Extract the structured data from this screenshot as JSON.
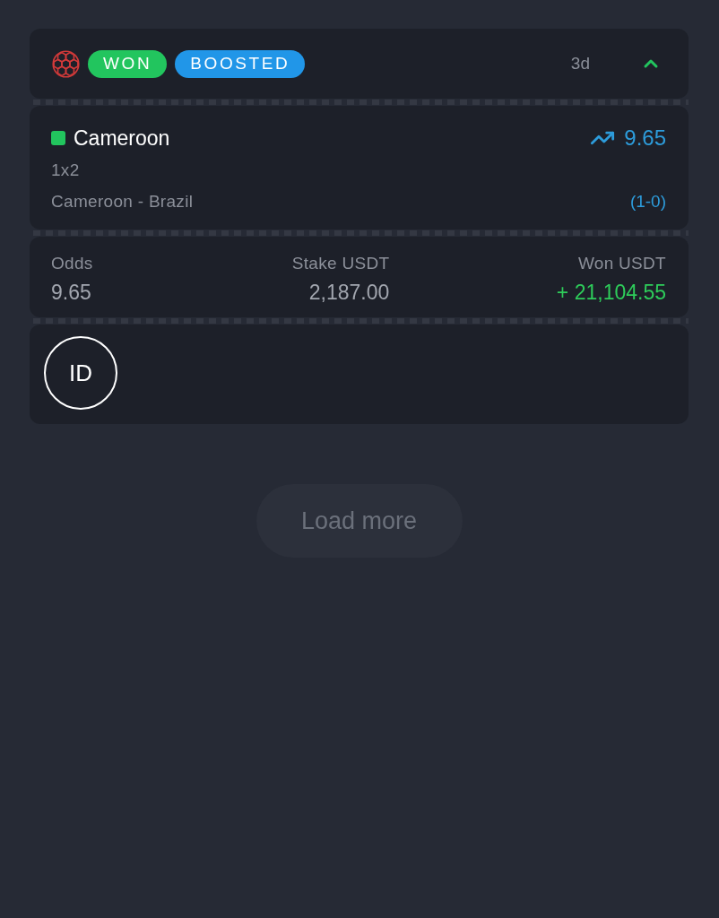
{
  "bet": {
    "sport": {
      "kind": "football"
    },
    "badges": [
      {
        "label": "WON",
        "kind": "won"
      },
      {
        "label": "BOOSTED",
        "kind": "boosted"
      }
    ],
    "age": "3d",
    "expanded": true
  },
  "selection": {
    "name": "Cameroon",
    "won": true,
    "market": "1x2",
    "event": "Cameroon - Brazil",
    "odds": "9.65",
    "score": "(1-0)"
  },
  "summary": [
    {
      "label": "Odds",
      "value": "9.65",
      "kind": "plain"
    },
    {
      "label": "Stake USDT",
      "value": "2,187.00",
      "kind": "plain"
    },
    {
      "label": "Won USDT",
      "value": "+ 21,104.55",
      "kind": "won"
    }
  ],
  "user": {
    "initials": "ID"
  },
  "load_more": {
    "label": "Load more"
  }
}
